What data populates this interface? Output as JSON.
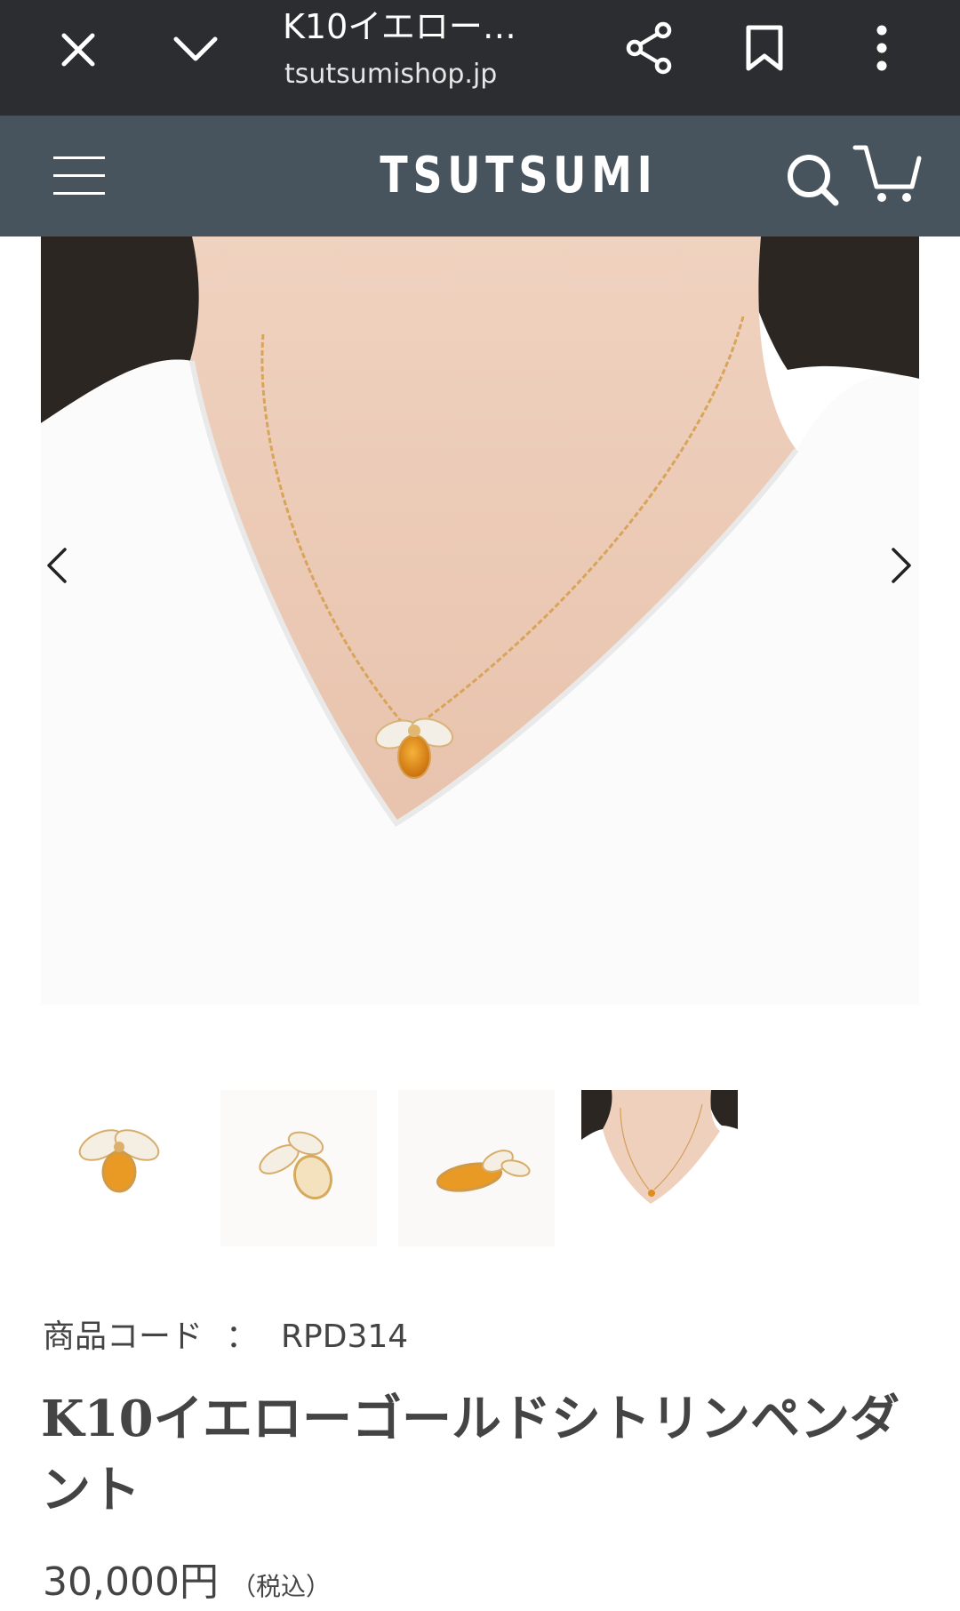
{
  "browser": {
    "title": "K10イエロー…",
    "url": "tsutsumishop.jp",
    "icons": [
      "close-icon",
      "chevron-down-icon",
      "share-icon",
      "bookmark-icon",
      "more-vert-icon"
    ]
  },
  "header": {
    "logo": "TSUTSUMI",
    "background": "#47545d",
    "icons": [
      "menu-icon",
      "search-icon",
      "cart-icon"
    ]
  },
  "gallery": {
    "main_image": "model wearing gold bee necklace with citrine pendant",
    "prev_icon": "chevron-left-icon",
    "next_icon": "chevron-right-icon",
    "thumbnails": [
      "bee pendant front",
      "bee pendant angled",
      "bee pendant side",
      "model wearing necklace"
    ],
    "selected_index": 3
  },
  "product": {
    "code_label": "商品コード",
    "code_separator": "：",
    "code_value": "RPD314",
    "title": "K10イエローゴールドシトリンペンダント",
    "price": "30,000円",
    "tax_note": "（税込）"
  }
}
